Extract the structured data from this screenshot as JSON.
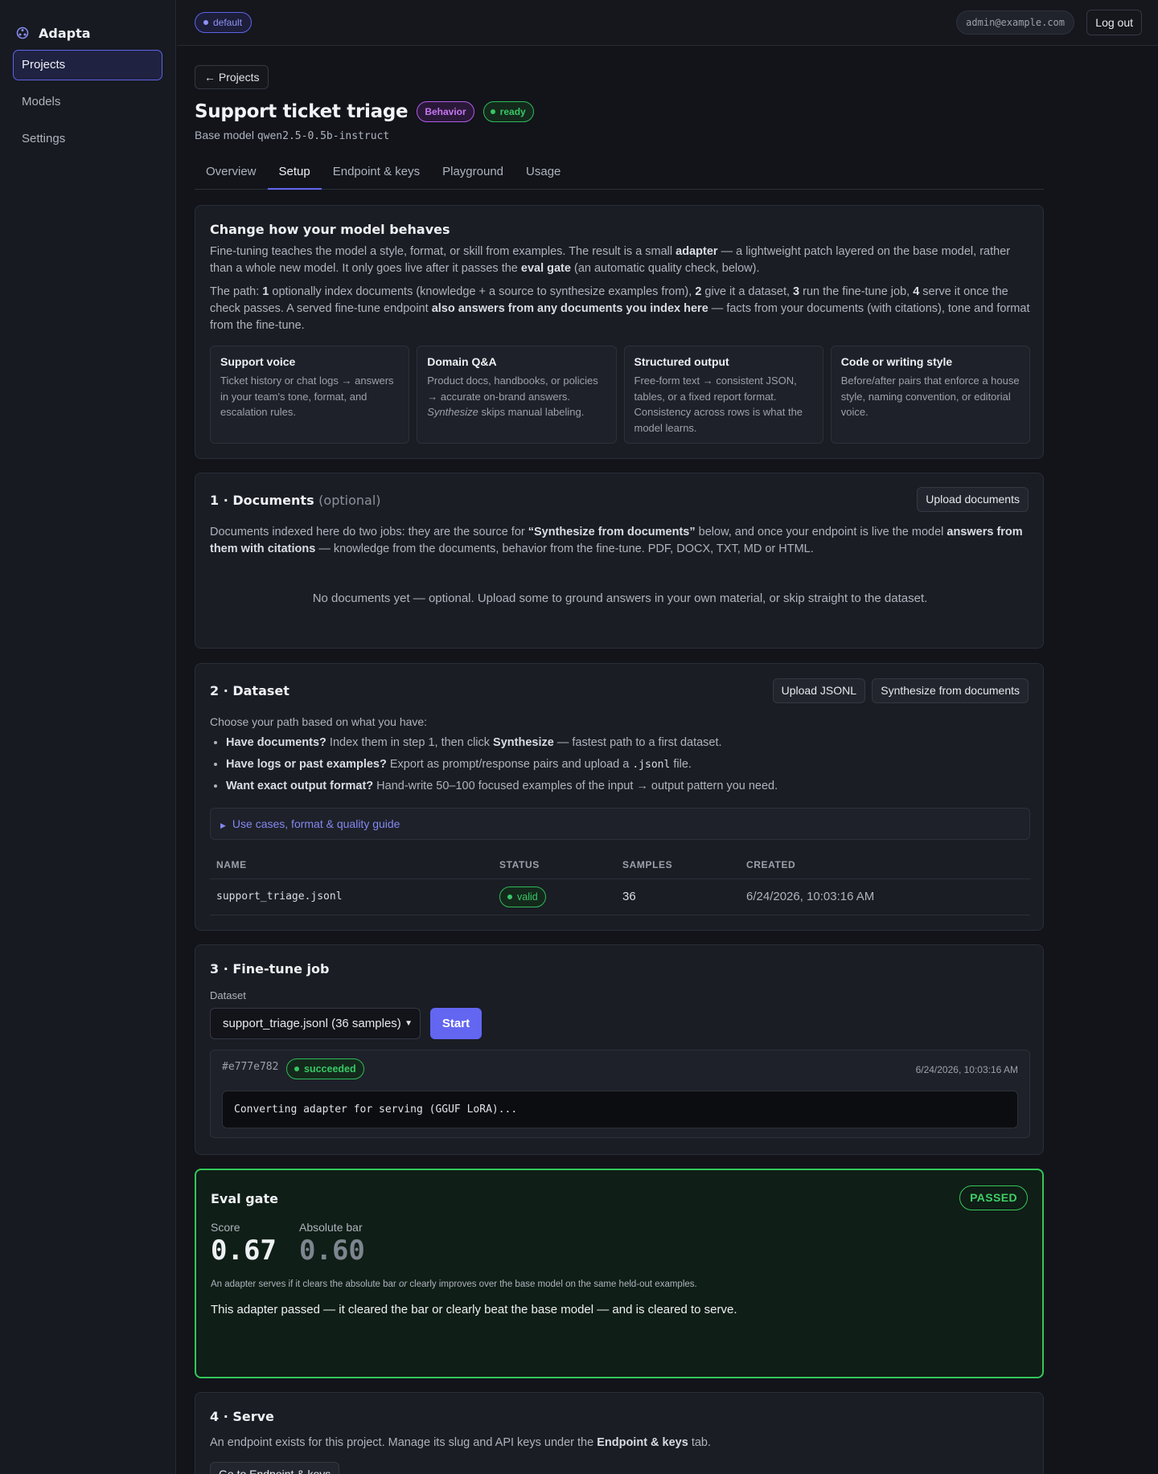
{
  "app": {
    "name": "Adapta",
    "accent": "#6366f1"
  },
  "sidebar": {
    "items": [
      {
        "label": "Projects",
        "active": true
      },
      {
        "label": "Models",
        "active": false
      },
      {
        "label": "Settings",
        "active": false
      }
    ]
  },
  "topbar": {
    "workspace": "default",
    "user_email": "admin@example.com",
    "logout_label": "Log out"
  },
  "project": {
    "back_label": "← Projects",
    "title": "Support ticket triage",
    "type_badge": "Behavior",
    "status_badge": "ready",
    "base_model_label": "Base model",
    "base_model": "qwen2.5-0.5b-instruct"
  },
  "tabs": [
    {
      "label": "Overview",
      "active": false
    },
    {
      "label": "Setup",
      "active": true
    },
    {
      "label": "Endpoint & keys",
      "active": false
    },
    {
      "label": "Playground",
      "active": false
    },
    {
      "label": "Usage",
      "active": false
    }
  ],
  "intro": {
    "title": "Change how your model behaves",
    "p1": {
      "t1": "Fine-tuning teaches the model a style, format, or skill from examples. The result is a small ",
      "b1": "adapter",
      "t2": " — a lightweight patch layered on the base model, rather than a whole new model. It only goes live after it passes the ",
      "b2": "eval gate",
      "t3": " (an automatic quality check, below)."
    },
    "p2": {
      "t1": "The path: ",
      "n1": "1",
      "t2": " optionally index documents (knowledge + a source to synthesize examples from), ",
      "n2": "2",
      "t3": " give it a dataset, ",
      "n3": "3",
      "t4": " run the fine-tune job, ",
      "n4": "4",
      "t5": " serve it once the check passes. A served fine-tune endpoint ",
      "b1": "also answers from any documents you index here",
      "t6": " — facts from your documents (with citations), tone and format from the fine-tune."
    },
    "use_cases": [
      {
        "title": "Support voice",
        "text": "Ticket history or chat logs → answers in your team's tone, format, and escalation rules."
      },
      {
        "title": "Domain Q&A",
        "text_a": "Product docs, handbooks, or policies → accurate on-brand answers. ",
        "text_em": "Synthesize",
        "text_b": " skips manual labeling."
      },
      {
        "title": "Structured output",
        "text": "Free-form text → consistent JSON, tables, or a fixed report format. Consistency across rows is what the model learns."
      },
      {
        "title": "Code or writing style",
        "text": "Before/after pairs that enforce a house style, naming convention, or editorial voice."
      }
    ]
  },
  "documents": {
    "title": "1 · Documents",
    "optional": "(optional)",
    "upload_label": "Upload documents",
    "desc": {
      "t1": "Documents indexed here do two jobs: they are the source for ",
      "b1": "“Synthesize from documents”",
      "t2": " below, and once your endpoint is live the model ",
      "b2": "answers from them with citations",
      "t3": " — knowledge from the documents, behavior from the fine-tune. PDF, DOCX, TXT, MD or HTML."
    },
    "empty": "No documents yet — optional. Upload some to ground answers in your own material, or skip straight to the dataset."
  },
  "dataset": {
    "title": "2 · Dataset",
    "upload_label": "Upload JSONL",
    "synth_label": "Synthesize from documents",
    "intro": "Choose your path based on what you have:",
    "bullets": [
      {
        "b": "Have documents?",
        "t1": " Index them in step 1, then click ",
        "b2": "Synthesize",
        "t2": " — fastest path to a first dataset."
      },
      {
        "b": "Have logs or past examples?",
        "t1": " Export as prompt/response pairs and upload a ",
        "code": ".jsonl",
        "t2": " file."
      },
      {
        "b": "Want exact output format?",
        "t1": " Hand-write 50–100 focused examples of the input → output pattern you need."
      }
    ],
    "guide_label": "Use cases, format & quality guide",
    "columns": [
      "NAME",
      "STATUS",
      "SAMPLES",
      "CREATED"
    ],
    "rows": [
      {
        "name": "support_triage.jsonl",
        "status": "valid",
        "samples": "36",
        "created": "6/24/2026, 10:03:16 AM"
      }
    ]
  },
  "finetune": {
    "title": "3 · Fine-tune job",
    "dataset_label": "Dataset",
    "selected_dataset": "support_triage.jsonl (36 samples)",
    "start_label": "Start",
    "job": {
      "id": "#e777e782",
      "status": "succeeded",
      "time": "6/24/2026, 10:03:16 AM",
      "log": "Converting adapter for serving (GGUF LoRA)..."
    }
  },
  "eval_gate": {
    "title": "Eval gate",
    "result_badge": "PASSED",
    "score_label": "Score",
    "score": "0.67",
    "bar_label": "Absolute bar",
    "bar": "0.60",
    "note_a": "An adapter serves if it clears the absolute bar ",
    "note_em": "or",
    "note_b": " clearly improves over the base model on the same held-out examples.",
    "result": "This adapter passed — it cleared the bar or clearly beat the base model — and is cleared to serve.",
    "color": "#34c759"
  },
  "serve": {
    "title": "4 · Serve",
    "t1": "An endpoint exists for this project. Manage its slug and API keys under the ",
    "b1": "Endpoint & keys",
    "t2": " tab.",
    "button_label": "Go to Endpoint & keys"
  }
}
